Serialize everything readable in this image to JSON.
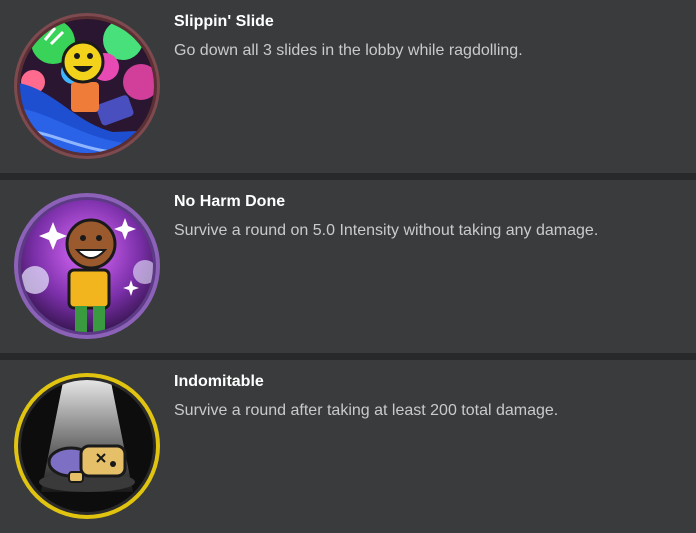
{
  "badges": [
    {
      "name": "Slippin' Slide",
      "description": "Go down all 3 slides in the lobby while ragdolling.",
      "ring_color": "#7d4a4f"
    },
    {
      "name": "No Harm Done",
      "description": "Survive a round on 5.0 Intensity without taking any damage.",
      "ring_color": "#8c62b8"
    },
    {
      "name": "Indomitable",
      "description": "Survive a round after taking at least 200 total damage.",
      "ring_color": "#e0c410"
    }
  ],
  "colors": {
    "background": "#393b3d",
    "divider": "#27292b",
    "title": "#ffffff",
    "description": "#c9cacc"
  }
}
